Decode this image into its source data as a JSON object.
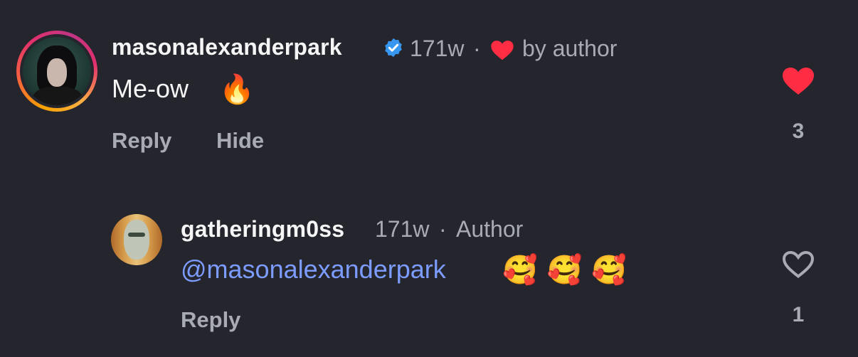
{
  "comments": [
    {
      "username": "masonalexanderpark",
      "verified": true,
      "time": "171w",
      "separator": "·",
      "liked_by_author_label": "by author",
      "text": "Me-ow",
      "emoji": "🔥",
      "actions": {
        "reply": "Reply",
        "hide": "Hide"
      },
      "like_count": "3",
      "liked": true,
      "like_color": "#ff2d43"
    },
    {
      "username": "gatheringm0ss",
      "time": "171w",
      "separator": "·",
      "badge": "Author",
      "mention": "@masonalexanderpark",
      "emoji": "🥰 🥰 🥰",
      "actions": {
        "reply": "Reply"
      },
      "like_count": "1",
      "liked": false
    }
  ],
  "colors": {
    "background": "#24252d",
    "verified": "#3797f0",
    "mention": "#7d9cff",
    "muted": "#a8abb4"
  }
}
